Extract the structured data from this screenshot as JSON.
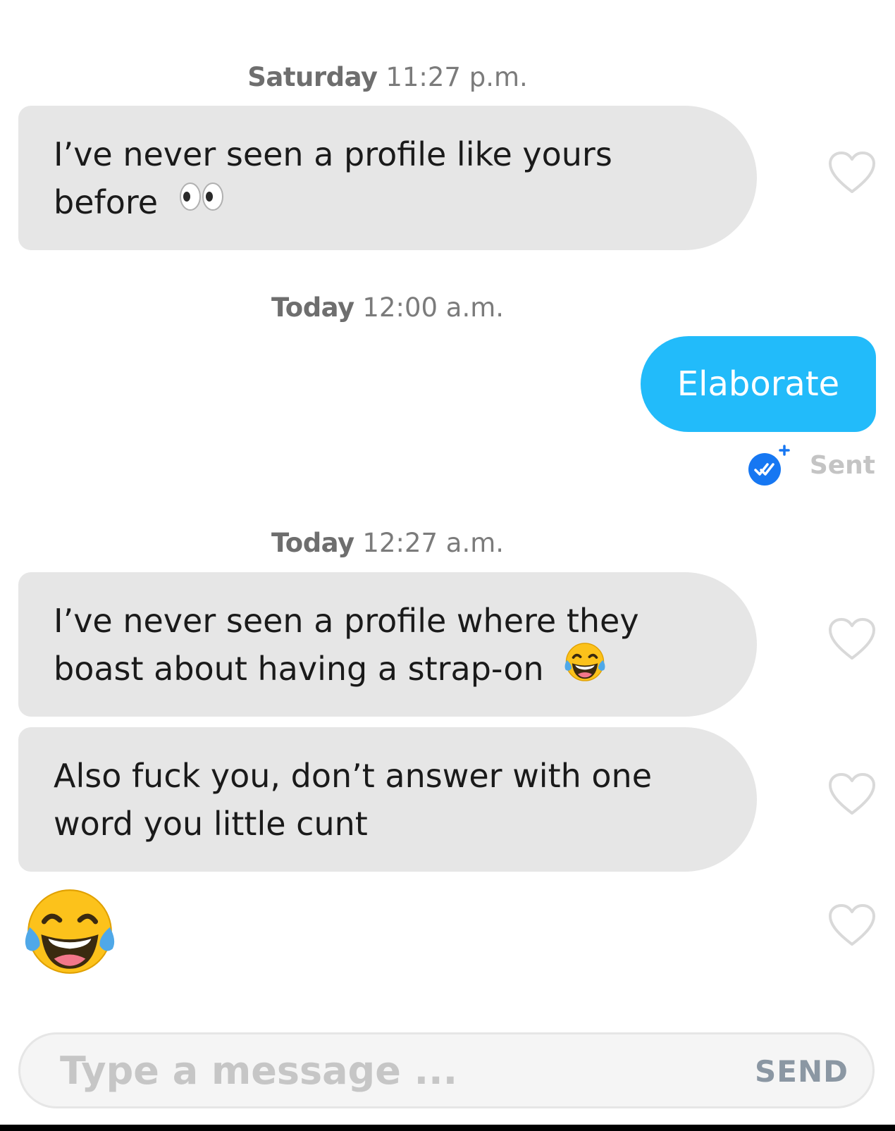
{
  "conversation": {
    "groups": [
      {
        "timestamp": {
          "day": "Saturday",
          "time": "11:27 p.m."
        },
        "messages": [
          {
            "direction": "incoming",
            "lines": [
              "I’ve never seen a profile like yours",
              "before"
            ],
            "emoji": "eyes-emoji"
          }
        ]
      },
      {
        "timestamp": {
          "day": "Today",
          "time": "12:00 a.m."
        },
        "messages": [
          {
            "direction": "outgoing",
            "text": "Elaborate",
            "status": "Sent"
          }
        ]
      },
      {
        "timestamp": {
          "day": "Today",
          "time": "12:27 a.m."
        },
        "messages": [
          {
            "direction": "incoming",
            "lines": [
              "I’ve never seen a profile where they",
              "boast about having a strap-on"
            ],
            "emoji": "tears-of-joy-emoji"
          },
          {
            "direction": "incoming",
            "lines": [
              "Also fuck you, don’t answer with one",
              "word you little cunt"
            ]
          },
          {
            "direction": "incoming",
            "emoji_only": "tears-of-joy-emoji"
          }
        ]
      }
    ]
  },
  "composer": {
    "placeholder": "Type a message ...",
    "send_label": "SEND"
  },
  "colors": {
    "incoming_bubble": "#e6e6e6",
    "outgoing_bubble": "#22bbfa",
    "read_receipt": "#1677f2",
    "timestamp_text": "#7b7b7b"
  },
  "icons": {
    "like": "heart-outline-icon",
    "read_receipt": "double-check-badge-icon"
  }
}
